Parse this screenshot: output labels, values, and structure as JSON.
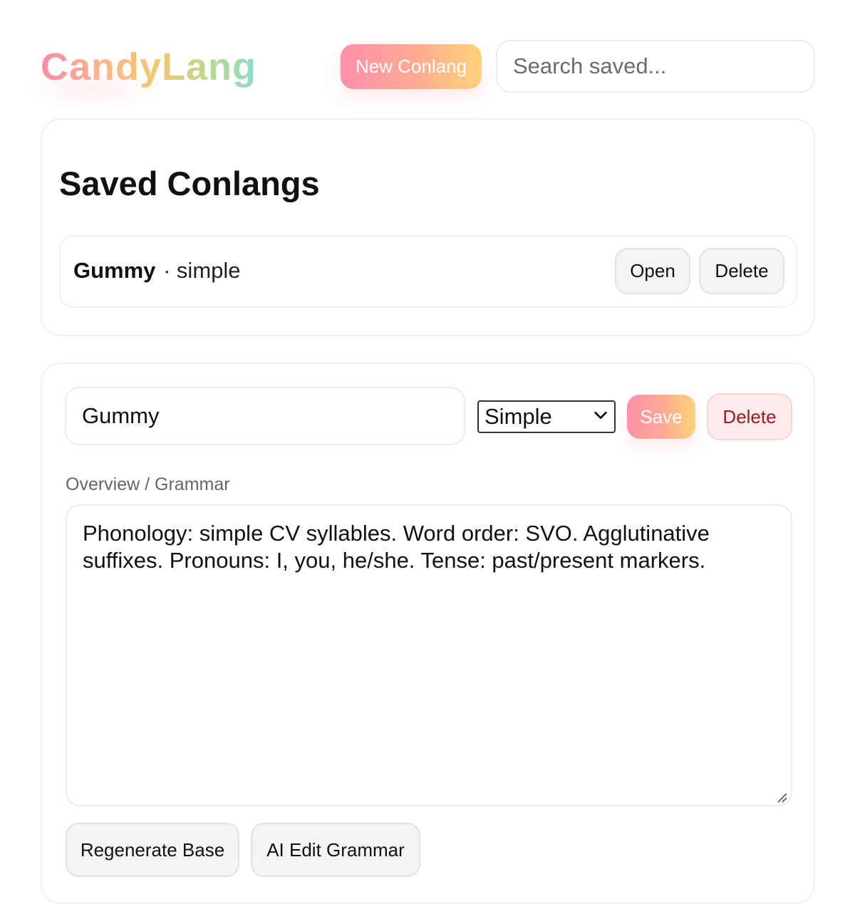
{
  "header": {
    "logo": "CandyLang",
    "new_button": "New Conlang",
    "search_placeholder": "Search saved..."
  },
  "saved": {
    "title": "Saved Conlangs",
    "items": [
      {
        "name": "Gummy",
        "type_label": "· simple",
        "open_label": "Open",
        "delete_label": "Delete"
      }
    ]
  },
  "editor": {
    "name_value": "Gummy",
    "type_selected": "Simple",
    "save_label": "Save",
    "delete_label": "Delete",
    "grammar_label": "Overview / Grammar",
    "grammar_text": "Phonology: simple CV syllables. Word order: SVO. Agglutinative suffixes. Pronouns: I, you, he/she. Tense: past/present markers.",
    "regenerate_label": "Regenerate Base",
    "ai_edit_label": "AI Edit Grammar"
  },
  "colors": {
    "accent_start": "#ff8fab",
    "accent_end": "#ffd27a",
    "danger_text": "#9b1c1c",
    "danger_bg": "#fdeaea"
  }
}
